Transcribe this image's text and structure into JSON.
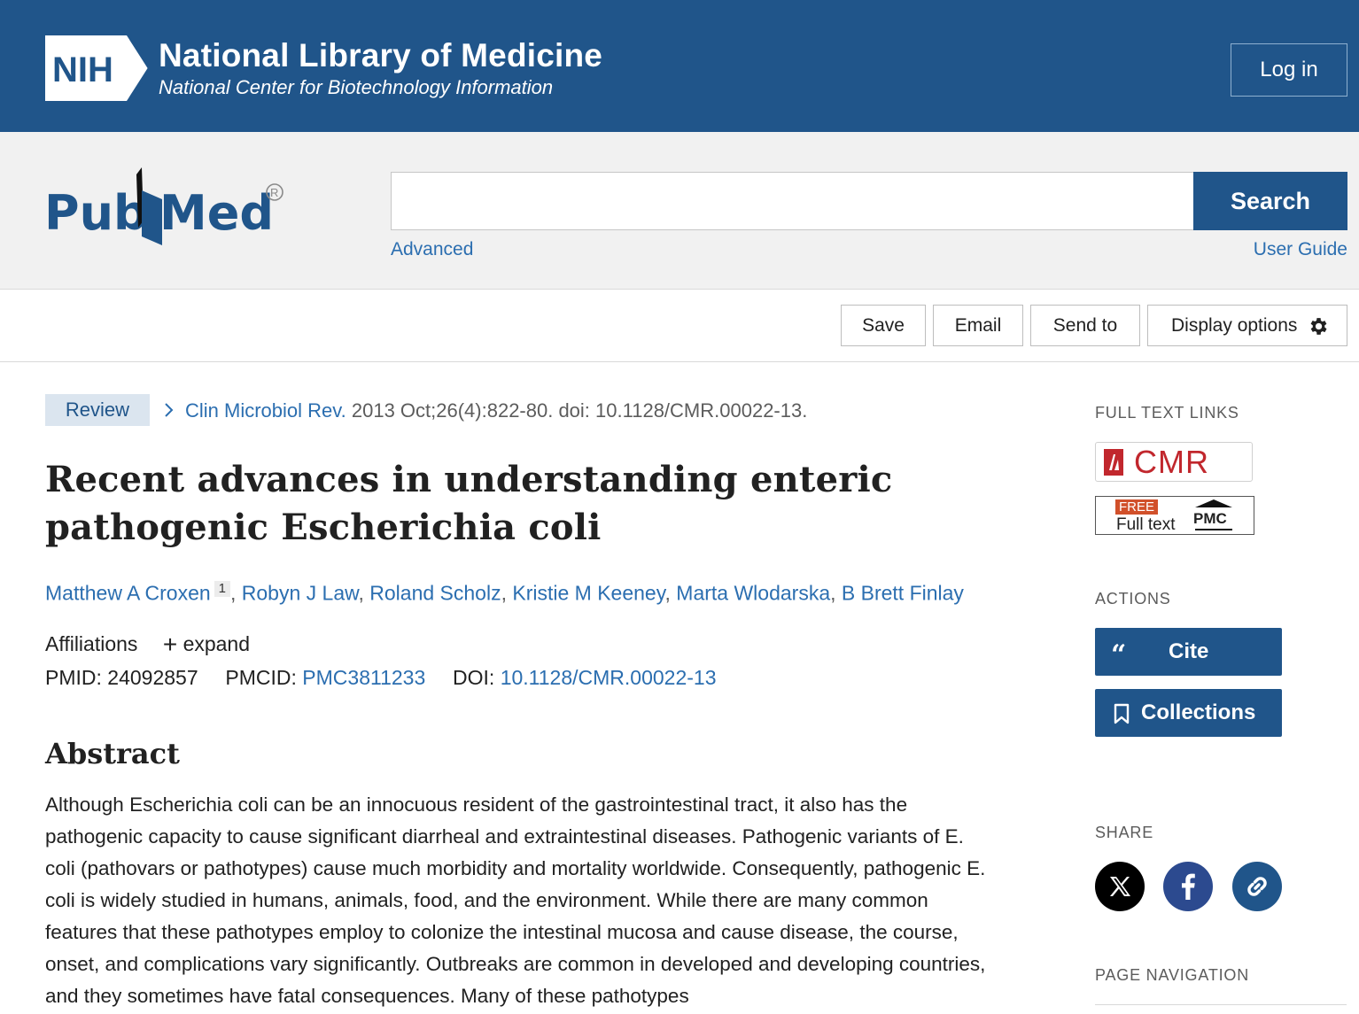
{
  "nih": {
    "logo_text": "NIH",
    "title": "National Library of Medicine",
    "subtitle": "National Center for Biotechnology Information",
    "login_label": "Log in"
  },
  "search": {
    "logo_text": "PubMed",
    "value": "",
    "button_label": "Search",
    "advanced_label": "Advanced",
    "user_guide_label": "User Guide"
  },
  "toolbar": {
    "save_label": "Save",
    "email_label": "Email",
    "send_label": "Send to",
    "display_label": "Display options"
  },
  "article": {
    "badge": "Review",
    "journal": "Clin Microbiol Rev.",
    "citation_rest": " 2013 Oct;26(4):822-80. doi: 10.1128/CMR.00022-13.",
    "title": "Recent advances in understanding enteric pathogenic Escherichia coli",
    "authors": [
      {
        "name": "Matthew A Croxen",
        "sup": "1"
      },
      {
        "name": "Robyn J Law"
      },
      {
        "name": "Roland Scholz"
      },
      {
        "name": "Kristie M Keeney"
      },
      {
        "name": "Marta Wlodarska"
      },
      {
        "name": "B Brett Finlay"
      }
    ],
    "affiliations_label": "Affiliations",
    "expand_label": "expand",
    "pmid_label": "PMID:",
    "pmid": "24092857",
    "pmcid_label": "PMCID:",
    "pmcid": "PMC3811233",
    "doi_label": "DOI:",
    "doi": "10.1128/CMR.00022-13",
    "abstract_heading": "Abstract",
    "abstract_text": "Although Escherichia coli can be an innocuous resident of the gastrointestinal tract, it also has the pathogenic capacity to cause significant diarrheal and extraintestinal diseases. Pathogenic variants of E. coli (pathovars or pathotypes) cause much morbidity and mortality worldwide. Consequently, pathogenic E. coli is widely studied in humans, animals, food, and the environment. While there are many common features that these pathotypes employ to colonize the intestinal mucosa and cause disease, the course, onset, and complications vary significantly. Outbreaks are common in developed and developing countries, and they sometimes have fatal consequences. Many of these pathotypes"
  },
  "sidebar": {
    "full_text_heading": "FULL TEXT LINKS",
    "cmr_label": "CMR",
    "free_label": "FREE",
    "full_text_label": "Full text",
    "pmc_label": "PMC",
    "actions_heading": "ACTIONS",
    "cite_label": "Cite",
    "collections_label": "Collections",
    "share_heading": "SHARE",
    "page_nav_heading": "PAGE NAVIGATION"
  },
  "colors": {
    "nih_blue": "#20558a",
    "link_blue": "#2b6eb0",
    "cmr_red": "#c1272d"
  }
}
